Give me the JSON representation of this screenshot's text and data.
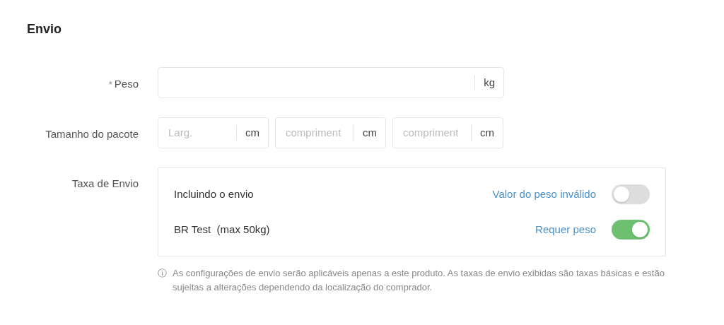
{
  "section_title": "Envio",
  "weight": {
    "required_mark": "*",
    "label": "Peso",
    "unit": "kg"
  },
  "package_size": {
    "label": "Tamanho do pacote",
    "fields": [
      {
        "placeholder": "Larg.",
        "unit": "cm"
      },
      {
        "placeholder": "compriment",
        "unit": "cm"
      },
      {
        "placeholder": "compriment",
        "unit": "cm"
      }
    ]
  },
  "shipping_fee": {
    "label": "Taxa de Envio",
    "options": [
      {
        "name": "Incluindo o envio",
        "status": "Valor do peso inválido",
        "on": false
      },
      {
        "name": "BR Test  (max 50kg)",
        "status": "Requer peso",
        "on": true
      }
    ]
  },
  "note": {
    "icon": "ⓘ",
    "text": "As configurações de envio serão aplicáveis apenas a este produto. As taxas de envio exibidas são taxas básicas e estão sujeitas a alterações dependendo da localização do comprador."
  }
}
